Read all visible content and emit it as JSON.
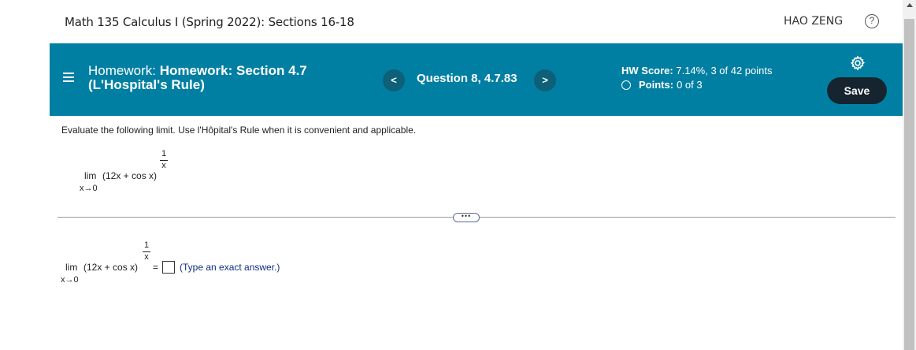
{
  "topbar": {
    "course_title": "Math 135 Calculus I (Spring 2022): Sections 16-18",
    "user_name": "HAO ZENG",
    "help_icon": "question-circle-icon",
    "help_glyph": "?"
  },
  "header": {
    "menu_icon": "hamburger-menu-icon",
    "title_prefix": "Homework:",
    "title_main": "Homework: Section 4.7",
    "title_line2": "(L'Hospital's Rule)",
    "prev_glyph": "<",
    "next_glyph": ">",
    "question_label": "Question 8, 4.7.83",
    "score_label": "HW Score:",
    "score_value": "7.14%, 3 of 42 points",
    "points_label": "Points:",
    "points_value": "0 of 3",
    "gear_icon": "gear-icon",
    "save_label": "Save",
    "color": "#007fa3"
  },
  "problem": {
    "instructions": "Evaluate the following limit. Use l'Hôpital's Rule when it is convenient and applicable.",
    "lim": "lim",
    "expression": "(12x + cos x)",
    "exponent_num": "1",
    "exponent_den": "x",
    "subscript": "x→0",
    "equals": "=",
    "ellipsis": "•••",
    "answer_hint": "(Type an exact answer.)"
  }
}
